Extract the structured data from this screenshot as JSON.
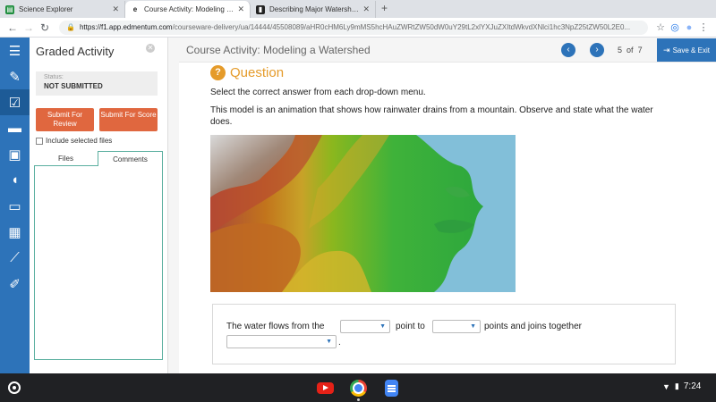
{
  "browser": {
    "tabs": [
      {
        "title": "Science Explorer",
        "icon": "science-explorer-icon",
        "active": false
      },
      {
        "title": "Course Activity: Modeling a Wat",
        "icon": "edmentum-icon",
        "active": true
      },
      {
        "title": "Describing Major Watershed Sys",
        "icon": "document-icon",
        "active": false
      }
    ],
    "url_host": "https://f1.app.edmentum.com",
    "url_path": "/courseware-delivery/ua/14444/45508089/aHR0cHM6Ly9mMS5hcHAuZWRtZW50dW0uY29tL2xlYXJuZXItdWkvdXNlci1hc3NpZ25tZW50L2E0..."
  },
  "sidebar": {
    "title": "Graded Activity",
    "status_label": "Status:",
    "status_value": "NOT SUBMITTED",
    "submit_review": "Submit For Review",
    "submit_score": "Submit For Score",
    "include_files": "Include selected files",
    "tab_files": "Files",
    "tab_comments": "Comments"
  },
  "header": {
    "course_title": "Course Activity: Modeling a Watershed",
    "page_current": "5",
    "page_of": "of",
    "page_total": "7",
    "save_exit": "Save & Exit"
  },
  "question": {
    "heading": "Question",
    "instruction": "Select the correct answer from each drop-down menu.",
    "description": "This model is an animation that shows how rainwater drains from a mountain. Observe and state what the water does.",
    "answer_part1": "The water flows from the",
    "answer_part2": "point to",
    "answer_part3": "points and joins together",
    "answer_end": ".",
    "dropdown1_value": "",
    "dropdown2_value": "",
    "dropdown3_value": ""
  },
  "shelf": {
    "time": "7:24",
    "apps": [
      "youtube-icon",
      "chrome-icon",
      "docs-icon"
    ]
  }
}
